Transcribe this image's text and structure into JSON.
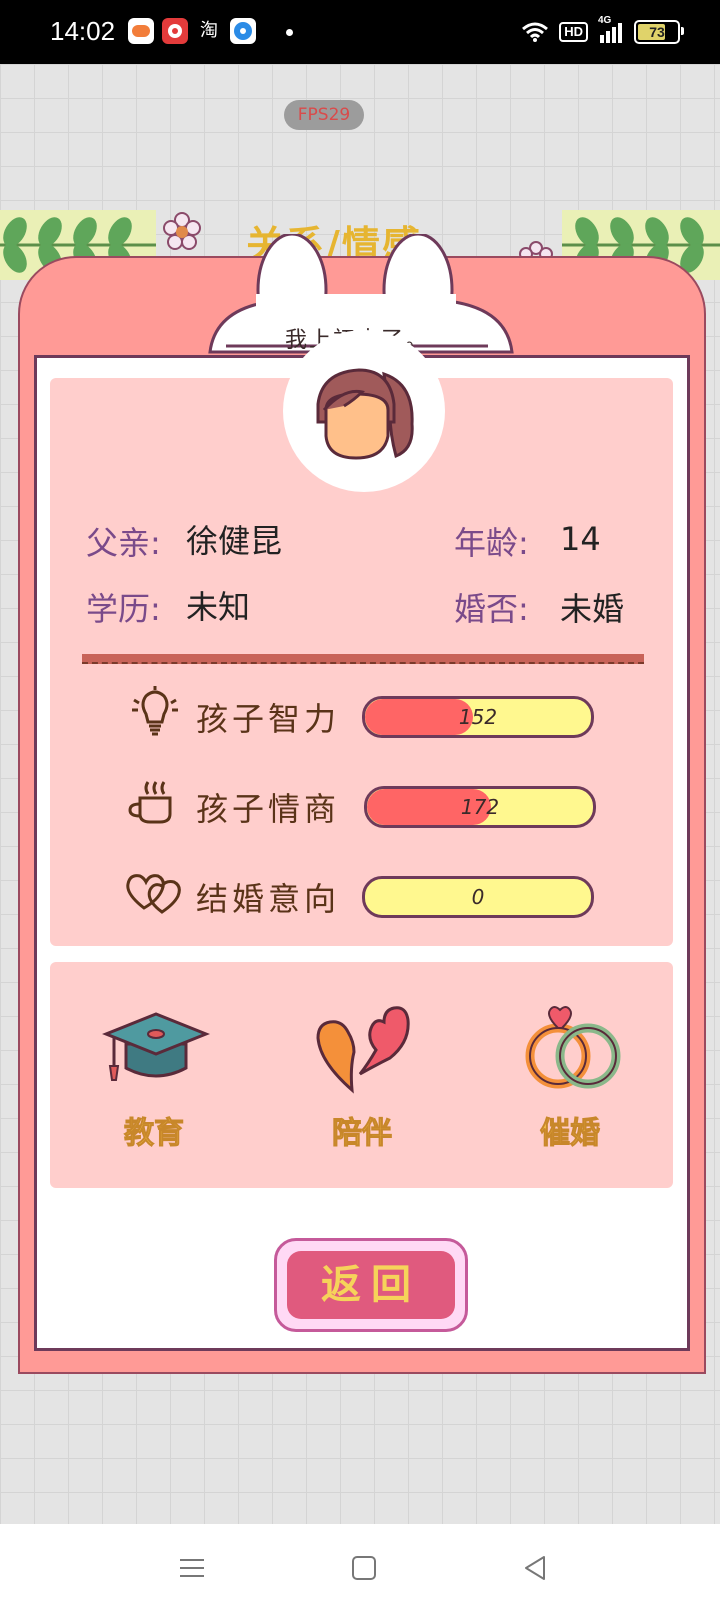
{
  "status_bar": {
    "time": "14:02",
    "apps": [
      "game-app-icon",
      "red-app-icon",
      "taobao-icon",
      "blue-app-icon"
    ],
    "taobao_label": "淘",
    "hd": "HD",
    "network": "4G",
    "battery": "73",
    "battery_level": 0.73
  },
  "background": {
    "fps": "FPS29",
    "title": "关系/情感"
  },
  "speech": "我上初中了。",
  "info": {
    "father_label": "父亲:",
    "father_value": "徐健昆",
    "age_label": "年龄:",
    "age_value": "14",
    "education_label": "学历:",
    "education_value": "未知",
    "marital_label": "婚否:",
    "marital_value": "未婚"
  },
  "stats": [
    {
      "label": "孩子智力",
      "value": "152",
      "fill": 0.48,
      "icon": "lightbulb-icon"
    },
    {
      "label": "孩子情商",
      "value": "172",
      "fill": 0.55,
      "icon": "coffee-cup-icon"
    },
    {
      "label": "结婚意向",
      "value": "0",
      "fill": 0.0,
      "icon": "hearts-icon"
    }
  ],
  "actions": [
    {
      "label": "教育",
      "icon": "graduation-cap-icon"
    },
    {
      "label": "陪伴",
      "icon": "broken-heart-icon"
    },
    {
      "label": "催婚",
      "icon": "rings-icon"
    }
  ],
  "return_label": "返回",
  "colors": {
    "dialog": "#ff9a96",
    "panel": "#ffcecc",
    "bar_fill": "#ff6565",
    "bar_bg": "#fff88f",
    "return_button": "#e05a7e"
  }
}
